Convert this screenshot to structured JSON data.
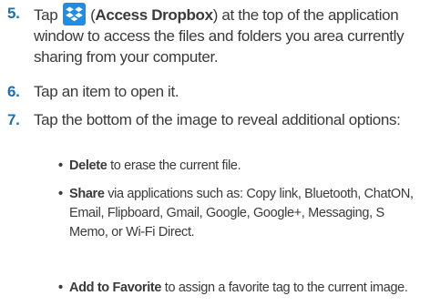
{
  "steps": [
    {
      "number": "5.",
      "text_before": "Tap ",
      "icon": "dropbox-icon",
      "text_paren_open": " (",
      "bold": "Access Dropbox",
      "text_after": ") at the top of the application window to access the files and folders you area currently sharing from your computer."
    },
    {
      "number": "6.",
      "text": "Tap an item to open it."
    },
    {
      "number": "7.",
      "text": "Tap the bottom of the image to reveal additional options:"
    }
  ],
  "bullets": [
    {
      "symbol": "•",
      "bold": "Delete",
      "text": " to erase the current file."
    },
    {
      "symbol": "•",
      "bold": "Share",
      "text": " via applications such as: Copy link, Bluetooth, ChatON, Email, Flipboard, Gmail, Google, Google+, Messaging, S Memo, or Wi-Fi Direct."
    },
    {
      "symbol": "•",
      "bold": "Add to Favorite",
      "text": " to assign a favorite tag to the current image."
    }
  ],
  "colors": {
    "step_number": "#1a6fb5",
    "body_text": "#3a3a3a",
    "dropbox_blue": "#1f8ce6"
  }
}
